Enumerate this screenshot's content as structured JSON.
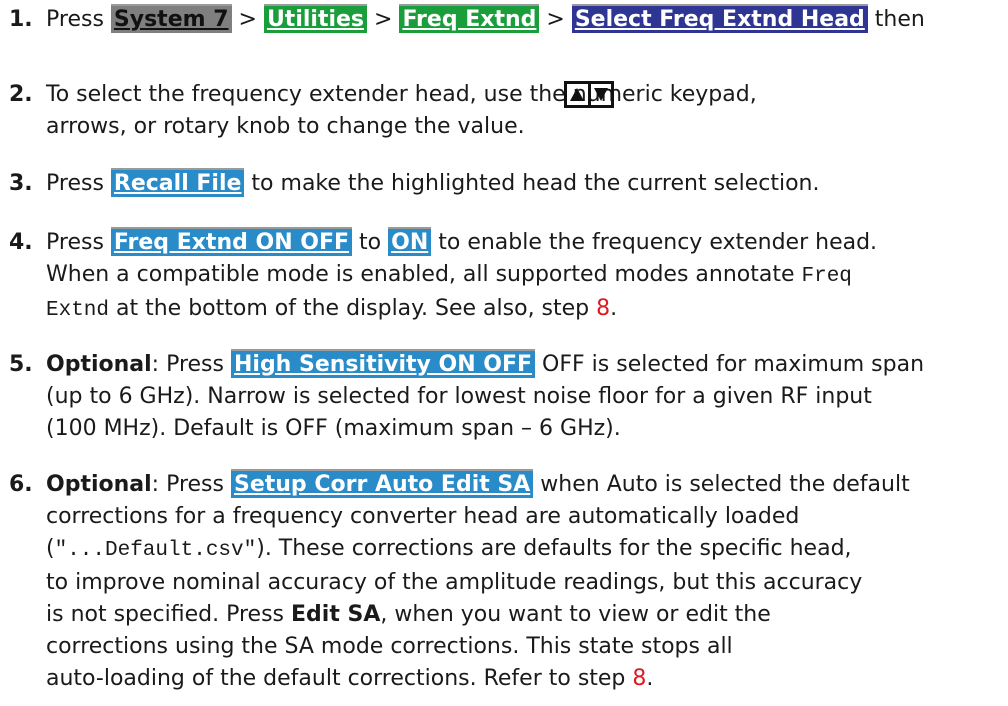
{
  "steps": [
    {
      "num": "1.",
      "press": "Press ",
      "keys": [
        "System 7",
        "Utilities",
        "Freq Extnd",
        "Select Freq Extnd Head"
      ],
      "sep": " > ",
      "tail": " then"
    },
    {
      "num": "2.",
      "line1": "To select the frequency extender head, use the numeric keypad,",
      "line2": "arrows, or rotary knob to change the value.",
      "arrow_icon": "up-down-arrow-keys-icon"
    },
    {
      "num": "3.",
      "press": "Press ",
      "key": "Recall File",
      "tail": " to make the highlighted head the current selection."
    },
    {
      "num": "4.",
      "press": "Press ",
      "key": "Freq Extnd ON OFF",
      "to": " to ",
      "key2": "ON",
      "tail1": " to enable the frequency extender head.",
      "line2a": "When a compatible mode is enabled, all supported modes annotate ",
      "code1": "Freq",
      "code2": "Extnd",
      "line3b": " at the bottom of the display. See also, step ",
      "ref": "8",
      "end": "."
    },
    {
      "num": "5.",
      "optional": "Optional",
      "colon_press": ": Press ",
      "key": "High Sensitivity ON OFF",
      "tail1": " OFF is selected for maximum span",
      "line2": "(up to 6 GHz). Narrow is selected for lowest noise floor for a given RF input",
      "line3": "(100 MHz). Default is OFF (maximum span – 6 GHz)."
    },
    {
      "num": "6.",
      "optional": "Optional",
      "colon_press": ": Press ",
      "key": "Setup Corr Auto Edit SA",
      "tail1": " when Auto is selected the default",
      "line2": "corrections for a frequency converter head are automatically loaded",
      "line3a": "(",
      "code": "\"...Default.csv\"",
      "line3b": "). These corrections are defaults for the specific head,",
      "line4": "to improve nominal accuracy of the amplitude readings, but this accuracy",
      "line5a": "is not specified. Press ",
      "bold_edit": "Edit SA",
      "line5b": ", when you want to view or edit the",
      "line6": "corrections using the SA mode corrections. This state stops all",
      "line7a": "auto-loading of the default corrections. Refer to step ",
      "ref": "8",
      "end": "."
    }
  ]
}
